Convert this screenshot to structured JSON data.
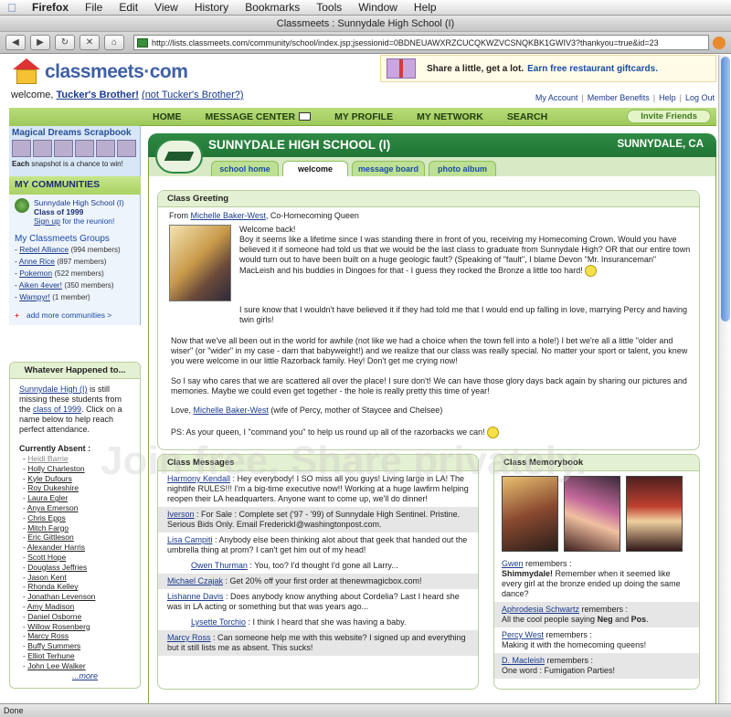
{
  "menubar": {
    "app": "Firefox",
    "items": [
      "File",
      "Edit",
      "View",
      "History",
      "Bookmarks",
      "Tools",
      "Window",
      "Help"
    ]
  },
  "window_title": "Classmeets : Sunnydale High School (I)",
  "url": "http://lists.classmeets.com/community/school/index.jsp;jsessionid=0BDNEUAWXRZCUCQKWZVCSNQKBK1GWIV3?thankyou=true&id=23",
  "status": "Done",
  "logo": "classmeets·com",
  "welcome": {
    "prefix": "welcome, ",
    "user": "Tucker's Brother!",
    "alt": "(not Tucker's Brother?)"
  },
  "promo": {
    "text": "Share a little, get a lot.",
    "link": "Earn free restaurant giftcards."
  },
  "toplinks": [
    "My Account",
    "Member Benefits",
    "Help",
    "Log Out"
  ],
  "nav": {
    "home": "HOME",
    "messages": "MESSAGE CENTER",
    "profile": "MY PROFILE",
    "network": "MY NETWORK",
    "search": "SEARCH",
    "invite": "Invite Friends"
  },
  "scrapbook": {
    "title": "Magical Dreams Scrapbook",
    "sub_bold": "Each",
    "sub": " snapshot is a chance to win!"
  },
  "communities": {
    "title": "MY COMMUNITIES",
    "school": "Sunnydale High School (I)",
    "year": "Class of 1999",
    "signup": "Sign up",
    "signup_rest": " for the reunion!",
    "groups_title": "My Classmeets Groups",
    "groups": [
      {
        "name": "Rebel Alliance",
        "count": "(994 members)"
      },
      {
        "name": "Anne Rice",
        "count": "(897 members)"
      },
      {
        "name": "Pokemon",
        "count": "(522 members)"
      },
      {
        "name": "Aiken 4ever!",
        "count": "(350 members)"
      },
      {
        "name": "Wampyr!",
        "count": "(1 member)"
      }
    ],
    "add": "add more communities >"
  },
  "whatever": {
    "title": "Whatever Happened to...",
    "school_link": "Sunnydale High (I)",
    "t1": " is still missing these students from the ",
    "class_link": "class of 1999",
    "t2": ". Click on a name below to help reach perfect attendance.",
    "absent_title": "Currently Absent :",
    "absent": [
      "Heidi Barrie",
      "Holly Charleston",
      "Kyle Dufours",
      "Roy Dukeshire",
      "Laura Egler",
      "Anya Emerson",
      "Chris Epps",
      "Mitch Fargo",
      "Eric Gittleson",
      "Alexander Harris",
      "Scott Hope",
      "Douglass Jeffries",
      "Jason Kent",
      "Rhonda Kelley",
      "Jonathan Levenson",
      "Amy Madison",
      "Daniel Osborne",
      "Willow Rosenberg",
      "Marcy Ross",
      "Buffy Summers",
      "Elliot Terhune",
      "John Lee Walker"
    ],
    "more": "...more"
  },
  "school": {
    "name": "SUNNYDALE HIGH SCHOOL (I)",
    "location": "SUNNYDALE, CA",
    "tabs": [
      "school home",
      "welcome",
      "message board",
      "photo album"
    ]
  },
  "greeting": {
    "title": "Class Greeting",
    "from_label": "From ",
    "from_name": "Michelle Baker-West",
    "from_role": ", Co-Homecoming Queen",
    "p1": "Welcome back!\nBoy it seems like a lifetime since I was standing there in front of you, receiving my Homecoming Crown. Would you have believed it if someone had told us that we would be the last class to graduate from Sunnydale High? OR that our entire town would turn out to have been built on a huge geologic fault? (Speaking of \"fault\", I blame Devon \"Mr. Insuranceman\" MacLeish and his buddies in Dingoes for that - I guess they rocked the Bronze a little too hard!",
    "p2": "I sure know that I wouldn't have believed it if they had told me that I would end up falling in love, marrying Percy and having twin girls!",
    "p3": "Now that we've all been out in the world for awhile (not like we had a choice when the town fell into a hole!) I bet we're all a little \"older and wiser\" (or \"wider\" in my case - darn that babyweight!) and we realize that our class was really special. No matter your sport or talent, you knew you were welcome in our little Razorback family. Hey! Don't get me crying now!",
    "p4": "So I say who cares that we are scattered all over the place! I sure don't! We can have those glory days back again by sharing our pictures and memories. Maybe we could even get together  - the hole is really pretty this time of year!",
    "love": "Love, ",
    "love_name": "Michelle Baker-West",
    "love_rest": " (wife of Percy, mother of Staycee and Chelsee)",
    "ps": "PS: As your queen, I \"command you\" to help us round up all of the razorbacks we can!"
  },
  "messages": {
    "title": "Class Messages",
    "items": [
      {
        "name": "Harmony Kendall",
        "text": " : Hey everybody! I SO miss all you guys! Living large in LA! The nightlife RULES!!! I'm a big-time executive now!! Working at a huge lawfirm helping reopen their LA headquarters. Anyone want to come up, we'll do dinner!"
      },
      {
        "name": "Iverson",
        "text": " : For Sale : Complete set ('97 - '99) of Sunnydale High Sentinel. Pristine. Serious Bids Only. Email FrederickI@washingtonpost.com."
      },
      {
        "name": "Lisa Campiti",
        "text": " :  Anybody else been thinking alot about that geek that handed out the umbrella thing at prom? I can't get him out of my head!"
      },
      {
        "name": "Owen Thurman",
        "text": " : You, too? I'd thought I'd gone all Larry..."
      },
      {
        "name": "Michael Czajak",
        "text": " : Get 20% off your first order at thenewmagicbox.com!"
      },
      {
        "name": "Lishanne Davis",
        "text": " : Does anybody know anything about Cordelia? Last I heard she was in LA acting or something but that was years ago..."
      },
      {
        "name": "Lysette Torchio",
        "text": " :  I think I heard that she was having a baby."
      },
      {
        "name": "Marcy Ross",
        "text": " :  Can someone help me with this website? I signed up and everything but it still lists me as absent. This sucks!"
      }
    ]
  },
  "memorybook": {
    "title": "Class Memorybook",
    "items": [
      {
        "name": "Gwen",
        "verb": " remembers :",
        "bold": "Shimmydale!",
        "text": " Remember when it seemed like every girl at the bronze ended up doing the same dance?"
      },
      {
        "name": "Aphrodesia Schwartz",
        "verb": " remembers :",
        "text": "All the cool people saying ",
        "b1": "Neg",
        "and": " and ",
        "b2": "Pos",
        "end": "."
      },
      {
        "name": "Percy West",
        "verb": " remembers :",
        "text": "Making it with the homecoming queens!"
      },
      {
        "name": "D. Macleish",
        "verb": " remembers :",
        "text": "One word : Fumigation Parties!"
      }
    ]
  },
  "watermark": "Join free. Share privately."
}
